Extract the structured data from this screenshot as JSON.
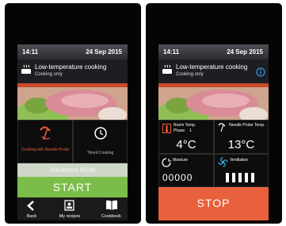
{
  "left": {
    "status": {
      "time": "14:11",
      "date": "24 Sep 2015"
    },
    "mode": {
      "title": "Low-temperature cooking",
      "subtitle": "Cooking only",
      "icon": "steam-pot-icon"
    },
    "tiles": [
      {
        "label": "Cooking with Needle Probe",
        "icon": "needle-probe-icon"
      },
      {
        "label": "Timed Cooking",
        "icon": "clock-icon"
      }
    ],
    "advanced_label": "Advanced Mode",
    "start_label": "START",
    "nav": [
      {
        "label": "Back",
        "icon": "back-chevron-icon"
      },
      {
        "label": "My recipes",
        "icon": "recipes-icon"
      },
      {
        "label": "Cookbook",
        "icon": "cookbook-icon"
      }
    ]
  },
  "right": {
    "status": {
      "time": "14:11",
      "date": "24 Sep 2015"
    },
    "mode": {
      "title": "Low-temperature cooking",
      "subtitle": "Cooking only",
      "icon": "steam-pot-icon",
      "info_icon": "info-icon"
    },
    "room": {
      "label": "Room Temp.",
      "phase_label": "Phase",
      "phase": "1",
      "value": "4°C"
    },
    "probe": {
      "label": "Needle Probe Temp.",
      "value": "13°C"
    },
    "moisture": {
      "label": "Moisture",
      "display": "00000"
    },
    "ventilation": {
      "label": "Ventilation"
    },
    "stop_label": "STOP"
  },
  "colors": {
    "accent_red": "#ee5a3c",
    "start_green": "#7cbd4a",
    "stop_orange": "#e8603c",
    "info_blue": "#3b8fe0"
  }
}
